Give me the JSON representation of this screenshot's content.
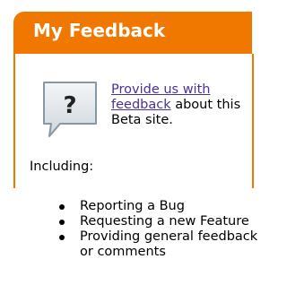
{
  "widget": {
    "title": "My Feedback",
    "icon": "question-speech-bubble-icon",
    "link_text": "Provide us with feedback",
    "intro_suffix": " about this Beta site.",
    "including_label": "Including:",
    "items": [
      "Reporting a Bug",
      "Requesting a new Feature",
      "Providing general feedback or comments"
    ],
    "colors": {
      "accent": "#f07800",
      "link": "#4b2f9a"
    }
  }
}
